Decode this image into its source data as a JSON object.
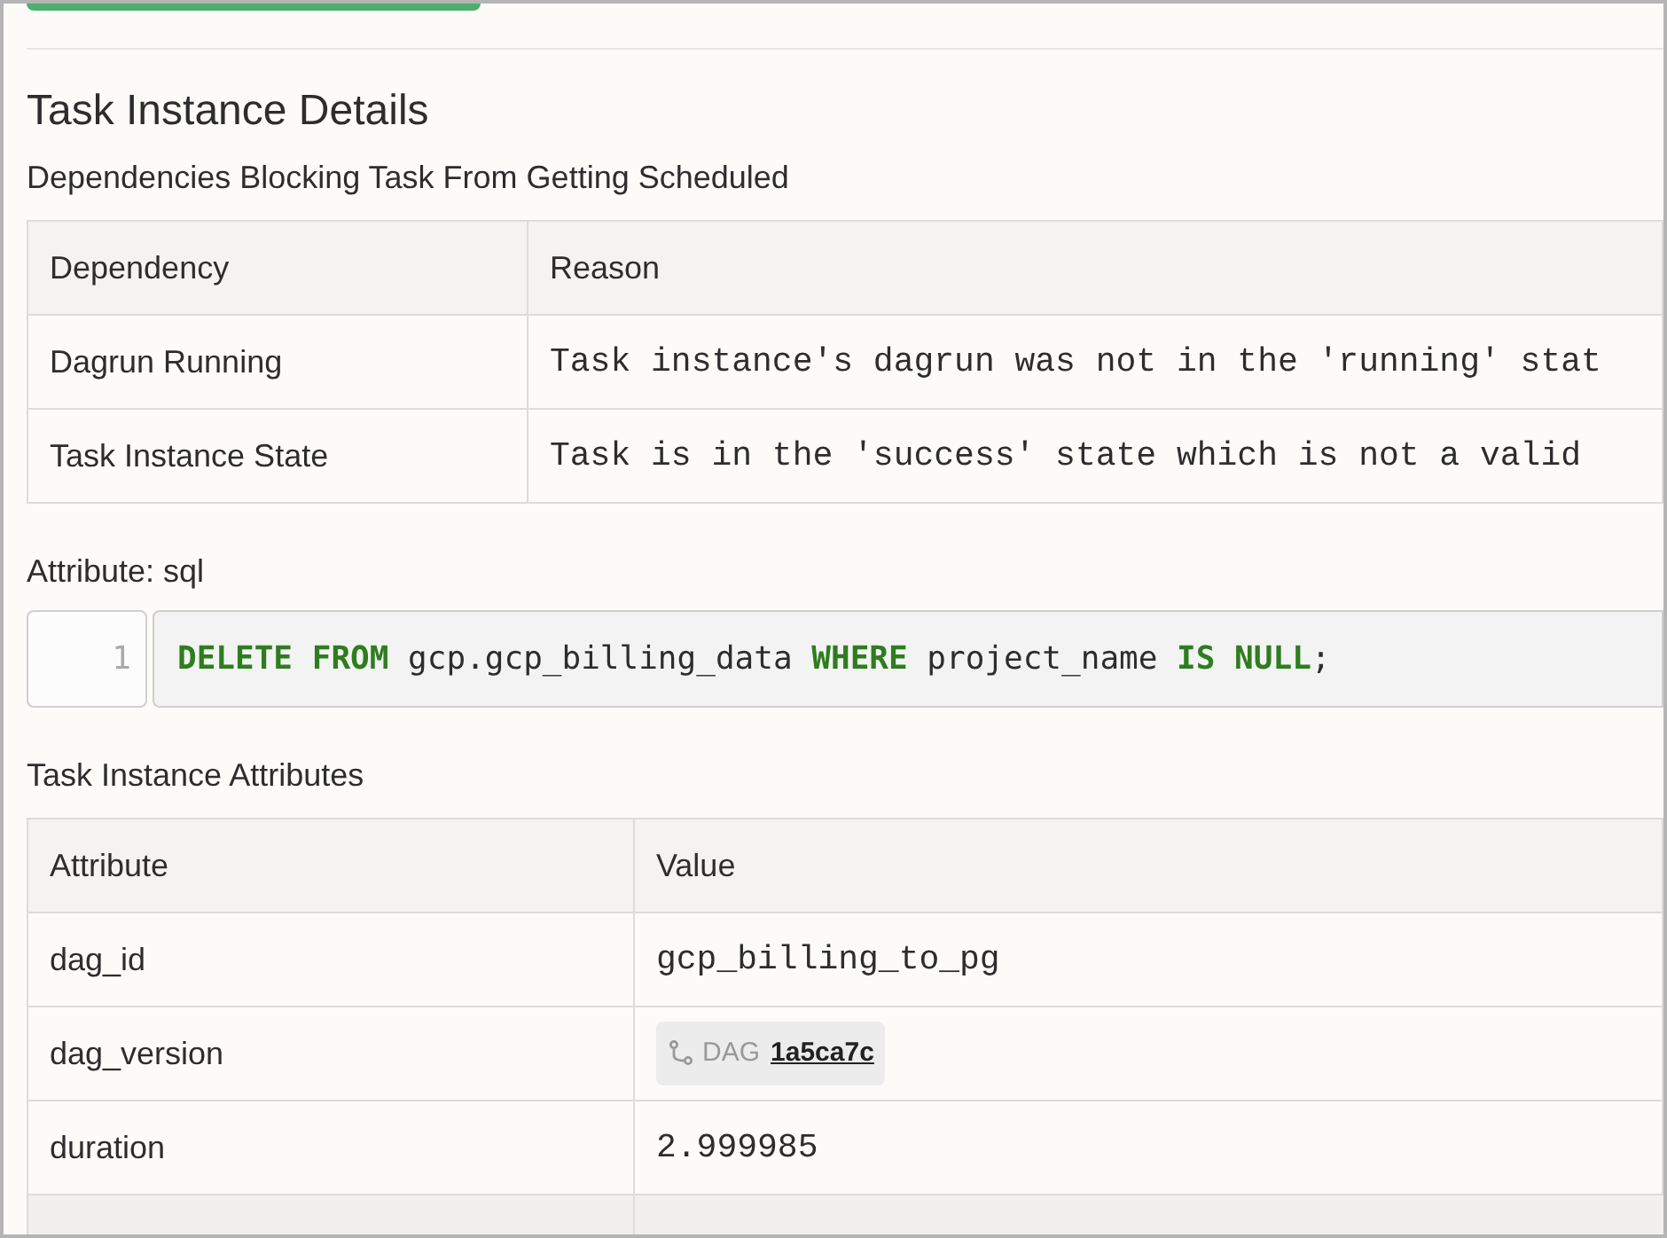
{
  "title": "Task Instance Details",
  "dependencies": {
    "heading": "Dependencies Blocking Task From Getting Scheduled",
    "columns": [
      "Dependency",
      "Reason"
    ],
    "rows": [
      {
        "dependency": "Dagrun Running",
        "reason": "Task instance's dagrun was not in the 'running' stat"
      },
      {
        "dependency": "Task Instance State",
        "reason": "Task is in the 'success' state which is not a valid"
      }
    ]
  },
  "sql": {
    "label": "Attribute: sql",
    "line_number": "1",
    "tokens": [
      {
        "text": "DELETE FROM",
        "kind": "keyword"
      },
      {
        "text": " gcp.gcp_billing_data ",
        "kind": "plain"
      },
      {
        "text": "WHERE",
        "kind": "keyword"
      },
      {
        "text": " project_name ",
        "kind": "plain"
      },
      {
        "text": "IS NULL",
        "kind": "keyword"
      },
      {
        "text": ";",
        "kind": "plain"
      }
    ]
  },
  "attributes": {
    "heading": "Task Instance Attributes",
    "columns": [
      "Attribute",
      "Value"
    ],
    "rows": [
      {
        "attribute": "dag_id",
        "kind": "text",
        "value": "gcp_billing_to_pg"
      },
      {
        "attribute": "dag_version",
        "kind": "version",
        "prefix": "DAG",
        "value": "1a5ca7c"
      },
      {
        "attribute": "duration",
        "kind": "text",
        "value": "2.999985"
      }
    ]
  }
}
